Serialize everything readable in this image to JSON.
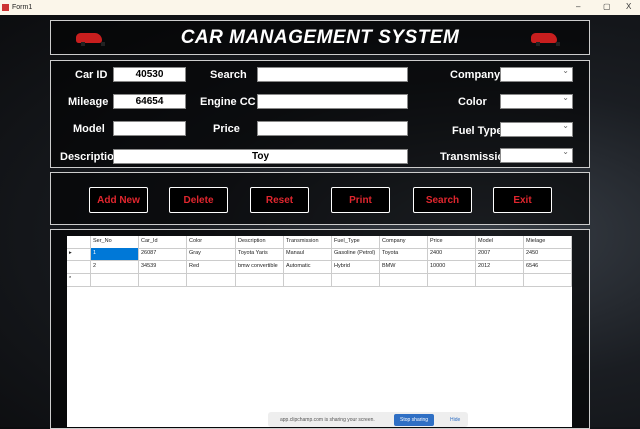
{
  "window": {
    "title": "Form1",
    "min": "–",
    "max": "▢",
    "close": "X"
  },
  "header": {
    "title": "CAR MANAGEMENT SYSTEM"
  },
  "form": {
    "car_id": {
      "label": "Car ID",
      "value": "40530"
    },
    "mileage": {
      "label": "Mileage",
      "value": "64654"
    },
    "model": {
      "label": "Model",
      "value": ""
    },
    "description": {
      "label": "Description",
      "value": "Toy"
    },
    "search": {
      "label": "Search",
      "value": ""
    },
    "engine_cc": {
      "label": "Engine CC",
      "value": ""
    },
    "price": {
      "label": "Price",
      "value": ""
    },
    "company": {
      "label": "Company",
      "value": ""
    },
    "color": {
      "label": "Color",
      "value": ""
    },
    "fuel_type": {
      "label": "Fuel Type",
      "value": ""
    },
    "transmission": {
      "label": "Transmission",
      "value": ""
    }
  },
  "buttons": [
    "Add New",
    "Delete",
    "Reset",
    "Print",
    "Search",
    "Exit"
  ],
  "grid": {
    "columns": [
      "Ser_No",
      "Car_Id",
      "Color",
      "Description",
      "Transmission",
      "Fuel_Type",
      "Company",
      "Price",
      "Model",
      "Mielage"
    ],
    "rows": [
      [
        "1",
        "26087",
        "Gray",
        "Toyota Yaris",
        "Manaul",
        "Gasoline (Petrol)",
        "Toyota",
        "2400",
        "2007",
        "2450"
      ],
      [
        "2",
        "34539",
        "Red",
        "bmw convertible",
        "Automatic",
        "Hybrid",
        "BMW",
        "10000",
        "2012",
        "6546"
      ]
    ],
    "current_marker": "▸",
    "new_marker": "*"
  },
  "share_bar": {
    "text": "app.clipchamp.com is sharing your screen.",
    "stop": "Stop sharing",
    "hide": "Hide"
  }
}
